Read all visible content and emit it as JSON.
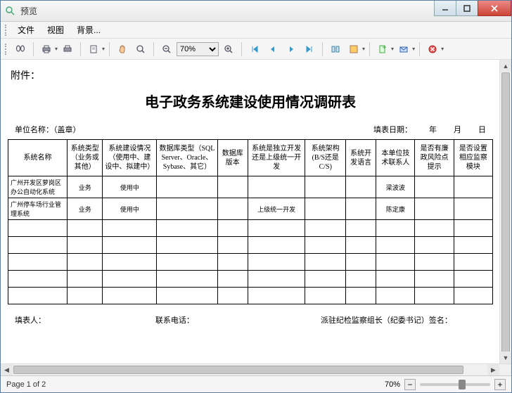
{
  "window": {
    "title": "预览"
  },
  "menu": {
    "file": "文件",
    "view": "视图",
    "background": "背景..."
  },
  "toolbar": {
    "zoom_value": "70%"
  },
  "document": {
    "attachment": "附件：",
    "title": "电子政务系统建设使用情况调研表",
    "unit_label": "单位名称：（盖章）",
    "fill_date_label": "填表日期：",
    "year": "年",
    "month": "月",
    "day": "日",
    "headers": [
      "系统名称",
      "系统类型（业务或其他）",
      "系统建设情况（使用中、建设中、拟建中）",
      "数据库类型（SQL Server、Oracle、Sybase、其它）",
      "数据库版本",
      "系统是独立开发还是上级统一开发",
      "系统架构(B/S还是C/S)",
      "系统开发语言",
      "本单位技术联系人",
      "是否有廉政风险点提示",
      "是否设置相应监察模块"
    ],
    "col_widths": [
      "70",
      "42",
      "64",
      "72",
      "36",
      "68",
      "48",
      "36",
      "46",
      "46",
      "46"
    ],
    "rows": [
      {
        "cells": [
          "广州开发区萝岗区办公自动化系统",
          "业务",
          "使用中",
          "",
          "",
          "",
          "",
          "",
          "梁波波",
          "",
          ""
        ]
      },
      {
        "cells": [
          "广州停车场行业管理系统",
          "业务",
          "使用中",
          "",
          "",
          "上级统一开发",
          "",
          "",
          "陈定康",
          "",
          ""
        ]
      },
      {
        "cells": [
          "",
          "",
          "",
          "",
          "",
          "",
          "",
          "",
          "",
          "",
          ""
        ]
      },
      {
        "cells": [
          "",
          "",
          "",
          "",
          "",
          "",
          "",
          "",
          "",
          "",
          ""
        ]
      },
      {
        "cells": [
          "",
          "",
          "",
          "",
          "",
          "",
          "",
          "",
          "",
          "",
          ""
        ]
      },
      {
        "cells": [
          "",
          "",
          "",
          "",
          "",
          "",
          "",
          "",
          "",
          "",
          ""
        ]
      },
      {
        "cells": [
          "",
          "",
          "",
          "",
          "",
          "",
          "",
          "",
          "",
          "",
          ""
        ]
      }
    ],
    "filler_label": "填表人：",
    "contact_label": "联系电话：",
    "signer_label": "派驻纪检监察组长（纪委书记）签名："
  },
  "status": {
    "page": "Page 1 of 2",
    "zoom": "70%"
  }
}
